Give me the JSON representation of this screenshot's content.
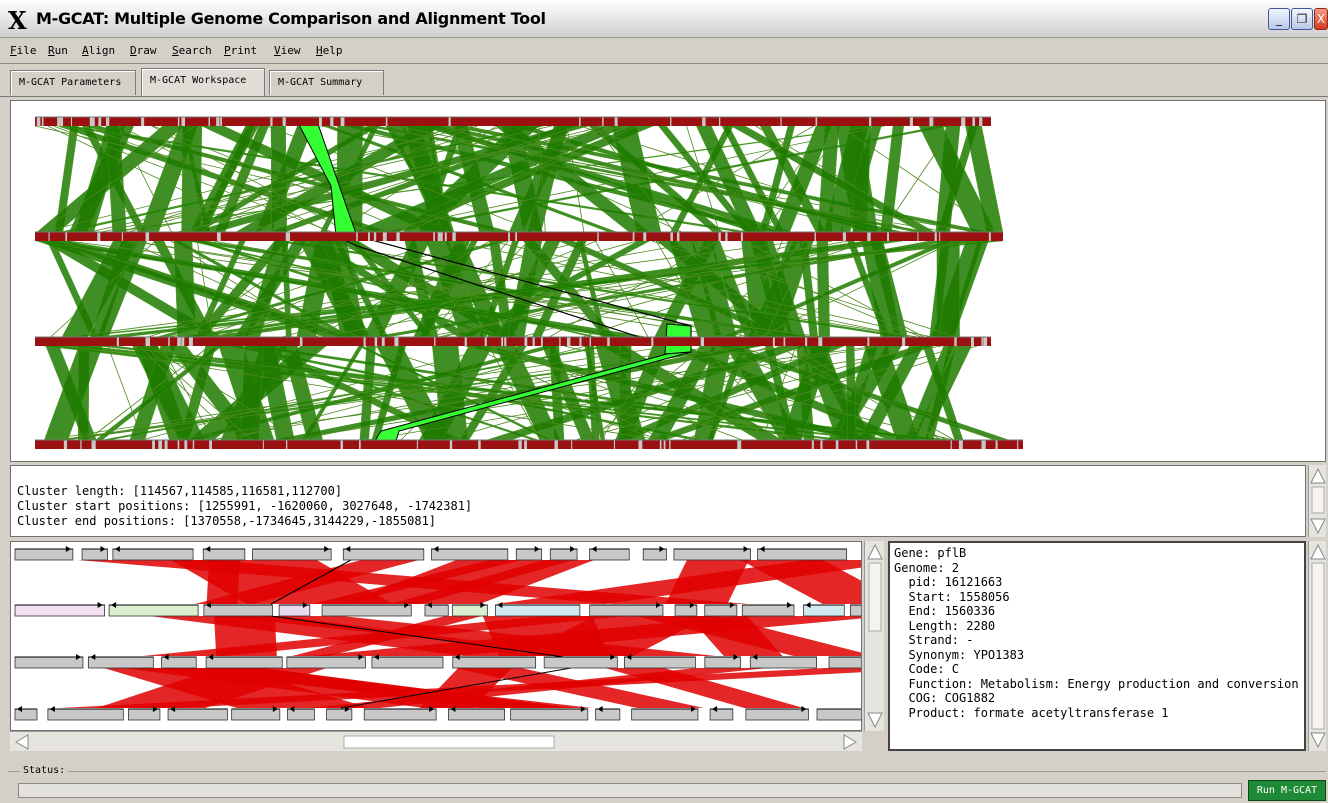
{
  "window": {
    "title": "M-GCAT: Multiple Genome Comparison and Alignment Tool",
    "buttons": [
      "_",
      "❐",
      "X"
    ]
  },
  "menu": [
    "File",
    "Run",
    "Align",
    "Draw",
    "Search",
    "Print",
    "View",
    "Help"
  ],
  "tabs": [
    {
      "label": "M-GCAT Parameters",
      "active": false
    },
    {
      "label": "M-GCAT Workspace",
      "active": true
    },
    {
      "label": "M-GCAT Summary",
      "active": false
    }
  ],
  "cluster_info": {
    "length": "Cluster length: [114567,114585,116581,112700]",
    "start": "Cluster start positions: [1255991, -1620060, 3027648, -1742381]",
    "end": "Cluster end positions: [1370558,-1734645,3144229,-1855081]"
  },
  "gene_info": {
    "lines": [
      "Gene: pflB",
      "Genome: 2",
      "  pid: 16121663",
      "  Start: 1558056",
      "  End: 1560336",
      "  Length: 2280",
      "  Strand: -",
      "  Synonym: YPO1383",
      "  Code: C",
      "  Function: Metabolism: Energy production and conversion",
      "  COG: COG1882",
      "  Product: formate acetyltransferase 1"
    ]
  },
  "status": {
    "label": "Status:",
    "run_button": "Run M-GCAT"
  },
  "colors": {
    "genome_bar": "#9b1010",
    "alignment": "#1f7a00",
    "highlight": "#33ff33",
    "gene_link": "#e00000",
    "gene_box": "#c8c8c8",
    "run_button": "#1f8a36"
  },
  "icons": {
    "x_logo": "x-logo-icon",
    "minimize": "minimize-icon",
    "restore": "restore-icon",
    "close": "close-icon"
  }
}
